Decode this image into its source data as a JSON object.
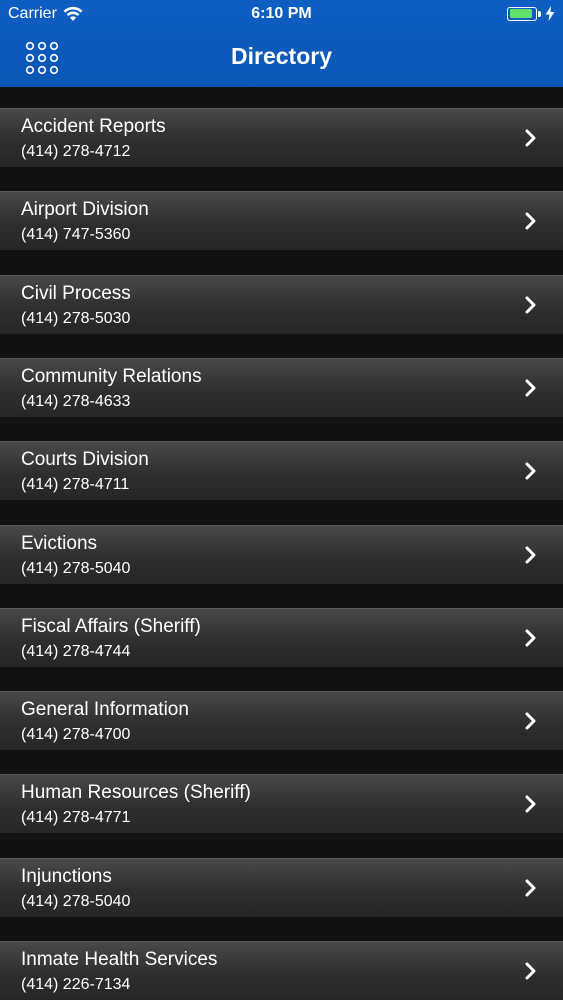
{
  "status_bar": {
    "carrier": "Carrier",
    "time": "6:10 PM",
    "battery_level": 0.92
  },
  "header": {
    "title": "Directory",
    "menu_icon": "grid-menu-icon"
  },
  "colors": {
    "header_blue": "#0c5ab9",
    "background": "#121212",
    "battery_green": "#5fe36a"
  },
  "directory": {
    "items": [
      {
        "name": "Accident Reports",
        "phone": "(414) 278-4712"
      },
      {
        "name": "Airport Division",
        "phone": "(414) 747-5360"
      },
      {
        "name": "Civil Process",
        "phone": "(414) 278-5030"
      },
      {
        "name": "Community Relations",
        "phone": "(414) 278-4633"
      },
      {
        "name": "Courts Division",
        "phone": "(414) 278-4711"
      },
      {
        "name": "Evictions",
        "phone": "(414) 278-5040"
      },
      {
        "name": "Fiscal Affairs (Sheriff)",
        "phone": "(414) 278-4744"
      },
      {
        "name": "General Information",
        "phone": "(414) 278-4700"
      },
      {
        "name": "Human Resources (Sheriff)",
        "phone": "(414) 278-4771"
      },
      {
        "name": "Injunctions",
        "phone": "(414) 278-5040"
      },
      {
        "name": "Inmate Health Services",
        "phone": "(414) 226-7134"
      }
    ]
  }
}
